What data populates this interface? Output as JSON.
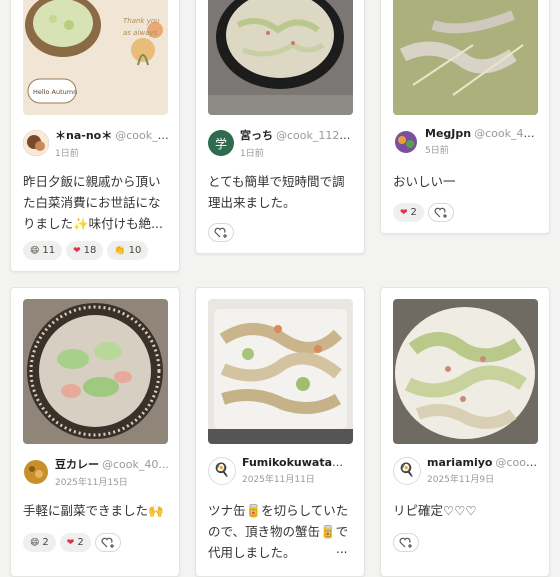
{
  "cards": [
    {
      "name": "＊na-no＊",
      "handle": "@cook_4...",
      "date": "1日前",
      "text": "昨日夕飯に親戚から頂いた白菜消費にお世話になりました✨味付けも絶...",
      "reactions": [
        {
          "icon": "grin-emoji-icon",
          "glyph": "😄",
          "count": "11"
        },
        {
          "icon": "heart-icon",
          "glyph": "❤",
          "count": "18"
        },
        {
          "icon": "clap-icon",
          "glyph": "👏",
          "count": "10"
        }
      ],
      "photo_text": {
        "line1": "Thank you",
        "line2": "as always",
        "badge": "Hello Autumn"
      },
      "avatar_glyph": ""
    },
    {
      "name": "宮っち",
      "handle": "@cook_1121...",
      "date": "1日前",
      "text": "とても簡単で短時間で調理出来ました。",
      "reactions": [],
      "avatar_glyph": "学"
    },
    {
      "name": "MegJpn",
      "handle": "@cook_400...",
      "date": "5日前",
      "text": "おいしい一",
      "reactions": [
        {
          "icon": "heart-icon",
          "glyph": "❤",
          "count": "2"
        }
      ],
      "avatar_glyph": ""
    },
    {
      "name": "豆カレー",
      "handle": "@cook_40...",
      "date": "2025年11月15日",
      "text": "手軽に副菜できました🙌",
      "reactions": [
        {
          "icon": "grin-emoji-icon",
          "glyph": "😄",
          "count": "2"
        },
        {
          "icon": "heart-icon",
          "glyph": "❤",
          "count": "2"
        }
      ],
      "avatar_glyph": ""
    },
    {
      "name": "Fumikokuwata",
      "handle": "...",
      "date": "2025年11月11日",
      "text": "ツナ缶🥫を切らしていたので、頂き物の蟹缶🥫で代用しました。",
      "more": "...",
      "reactions": [],
      "avatar_glyph": "🍳"
    },
    {
      "name": "mariamiyo",
      "handle": "@cook_...",
      "date": "2025年11月9日",
      "text": "リピ確定♡♡♡",
      "reactions": [],
      "avatar_glyph": "🍳"
    }
  ],
  "colors": {
    "heart": "#e0304a",
    "avatar2": "#2f6b4f",
    "background": "#f3f3f1"
  }
}
